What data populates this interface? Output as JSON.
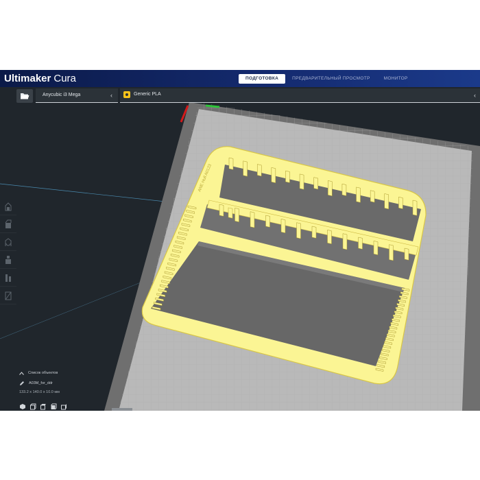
{
  "app": {
    "brand_primary": "Ultimaker",
    "brand_secondary": "Cura",
    "stages": [
      "ПОДГОТОВКА",
      "ПРЕДВАРИТЕЛЬНЫЙ ПРОСМОТР",
      "МОНИТОР"
    ],
    "active_stage_index": 0
  },
  "toolbar": {
    "printer": "Anycubic i3 Mega",
    "material": "Generic PLA",
    "open_file_icon": "folder-icon",
    "collapse_icon": "chevron-left-icon"
  },
  "left_tools": [
    "move-tool-icon",
    "scale-tool-icon",
    "rotate-tool-icon",
    "mirror-tool-icon",
    "per-model-settings-icon",
    "support-blocker-icon"
  ],
  "object_list": {
    "header": "Список объектов",
    "object_name": "A03M_for_ddr",
    "dimensions": "133.2 x 140.0 x 10.0 мм",
    "view_icons": [
      "3d-view-icon",
      "front-view-icon",
      "top-view-icon",
      "left-view-icon",
      "right-view-icon"
    ]
  },
  "model": {
    "engraved_text": "ANE  Hull  A0123"
  },
  "colors": {
    "header_bg": "#10225a",
    "viewport_bg": "#20262c",
    "build_plate": "#b9b9b9",
    "model_yellow": "#fbf594",
    "material_badge": "#f7c21a"
  }
}
